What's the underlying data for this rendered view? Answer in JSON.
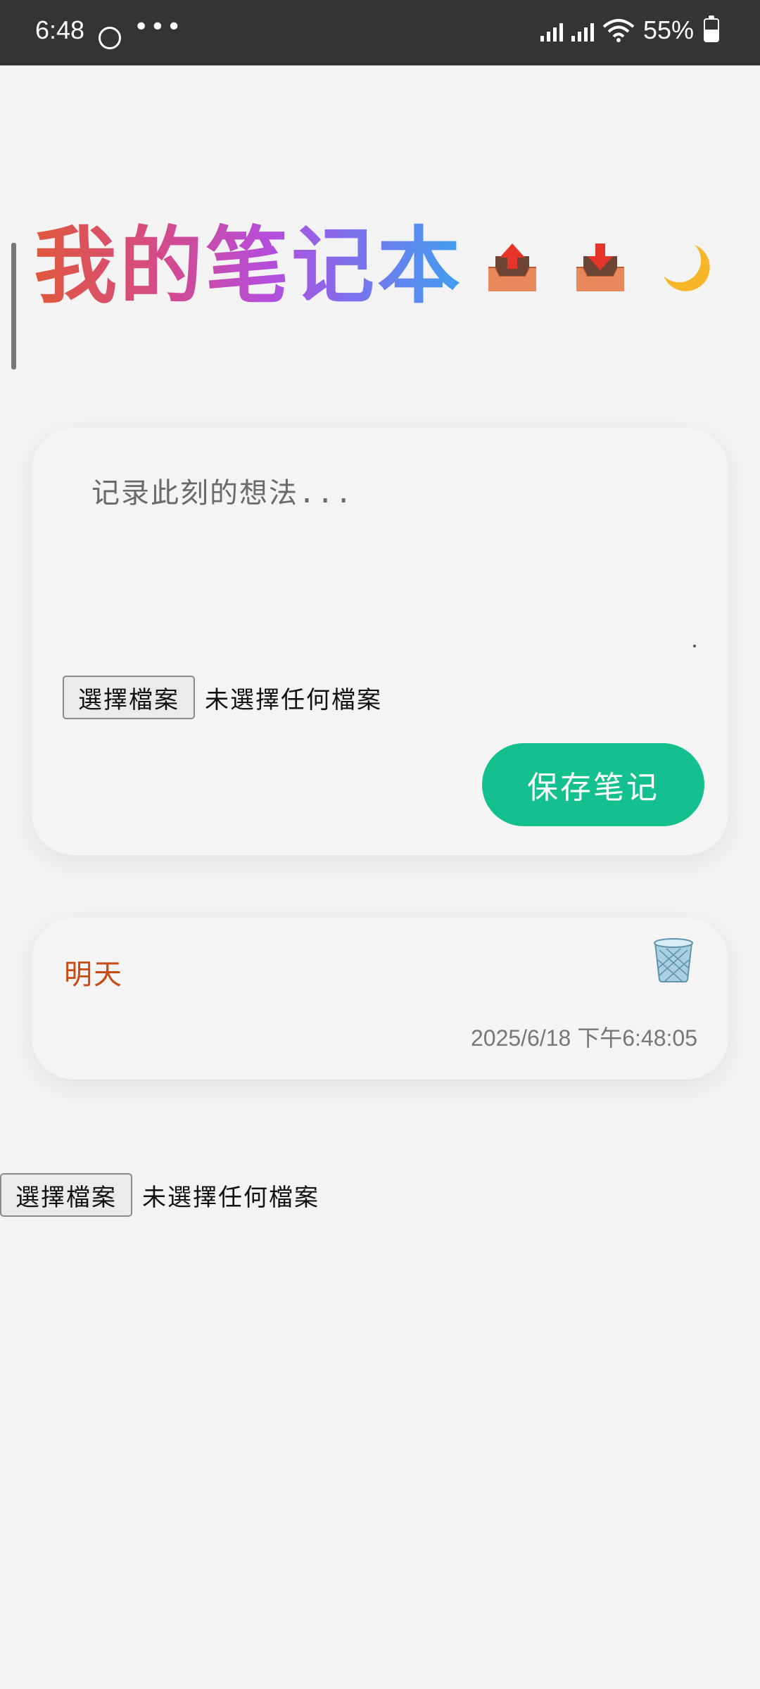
{
  "status_bar": {
    "time": "6:48",
    "more": "•••",
    "battery": "55%"
  },
  "header": {
    "title": "我的笔记本",
    "export_icon": "outbox-tray-icon",
    "import_icon": "inbox-tray-icon",
    "theme_icon": "crescent-moon-icon"
  },
  "composer": {
    "placeholder": "记录此刻的想法...",
    "file_button_label": "選擇檔案",
    "file_status": "未選擇任何檔案",
    "save_label": "保存笔记"
  },
  "notes": [
    {
      "text": "明天",
      "timestamp": "2025/6/18 下午6:48:05",
      "delete_icon": "wastebasket-icon"
    }
  ],
  "extra_file_input": {
    "button_label": "選擇檔案",
    "status": "未選擇任何檔案"
  },
  "colors": {
    "title_gradient": [
      "#e0583a",
      "#d44a8a",
      "#b44ddc",
      "#7a72ee",
      "#3fa0f0"
    ],
    "save_button": "#14c18e",
    "note_text": "#c94a12",
    "status_bar": "#343434",
    "background": "#f3f3f3"
  }
}
